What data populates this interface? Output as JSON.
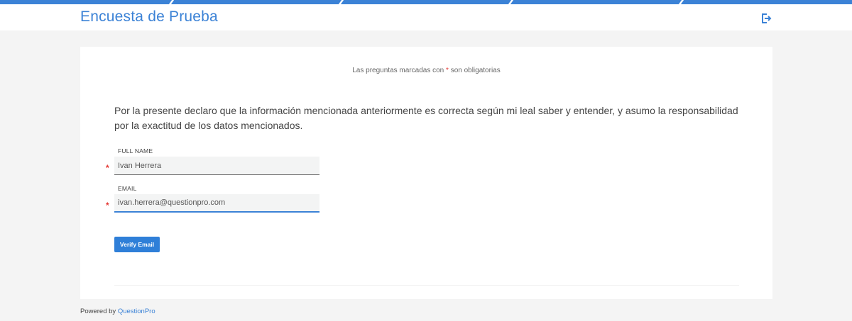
{
  "header": {
    "title": "Encuesta de Prueba",
    "logout_icon": "logout-icon"
  },
  "card": {
    "required_note_prefix": "Las preguntas marcadas con",
    "required_star": "*",
    "required_note_suffix": "son obligatorias",
    "declaration": "Por la presente declaro que la información mencionada anteriormente es correcta según mi leal saber y entender, y asumo la responsabilidad por la exactitud de los datos mencionados.",
    "fields": [
      {
        "label": "FULL NAME",
        "value": "Ivan Herrera",
        "required_mark": "*"
      },
      {
        "label": "EMAIL",
        "value": "ivan.herrera@questionpro.com",
        "required_mark": "*"
      }
    ],
    "verify_button": "Verify Email"
  },
  "footer": {
    "powered_by": "Powered by",
    "brand": "QuestionPro"
  },
  "colors": {
    "accent": "#3b82d6",
    "required": "#e53935",
    "background": "#f4f4f4"
  }
}
